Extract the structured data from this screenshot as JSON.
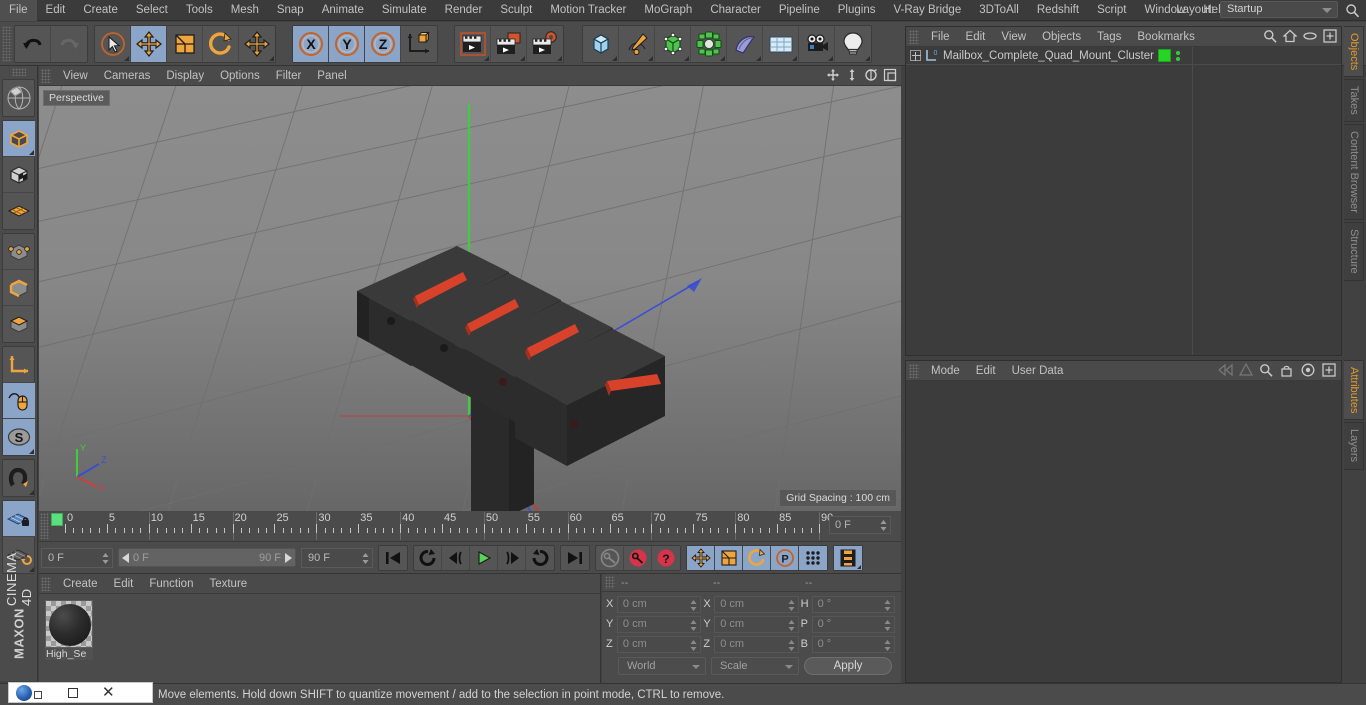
{
  "app": {
    "title": "MAXON CINEMA 4D",
    "brand_line1": "MAXON",
    "brand_line2": "CINEMA 4D"
  },
  "menubar": {
    "items": [
      "File",
      "Edit",
      "Create",
      "Select",
      "Tools",
      "Mesh",
      "Snap",
      "Animate",
      "Simulate",
      "Render",
      "Sculpt",
      "Motion Tracker",
      "MoGraph",
      "Character",
      "Pipeline",
      "Plugins",
      "V-Ray Bridge",
      "3DToAll",
      "Redshift",
      "Script",
      "Window",
      "Help"
    ],
    "layout_label": "Layout:",
    "layout_value": "Startup",
    "search_icon": "search-icon"
  },
  "toolbar": {
    "groups": [
      {
        "name": "history",
        "buttons": [
          {
            "name": "undo-button",
            "icon": "undo-icon",
            "active": false,
            "corner": false
          },
          {
            "name": "redo-button",
            "icon": "redo-icon",
            "active": false,
            "corner": false
          }
        ]
      },
      {
        "name": "transform-tools",
        "buttons": [
          {
            "name": "live-selection-tool",
            "icon": "cursor-circle-icon",
            "active": false,
            "corner": true
          },
          {
            "name": "move-tool",
            "icon": "move-arrows-icon",
            "active": true,
            "corner": false
          },
          {
            "name": "scale-tool",
            "icon": "scale-box-icon",
            "active": false,
            "corner": false
          },
          {
            "name": "rotate-tool",
            "icon": "rotate-arc-icon",
            "active": false,
            "corner": false
          },
          {
            "name": "free-move-tool",
            "icon": "move-arrows-icon",
            "active": false,
            "corner": true
          }
        ]
      },
      {
        "name": "axis-locks",
        "buttons": [
          {
            "name": "lock-x-axis-button",
            "icon": "x-axis-icon",
            "active": true,
            "corner": false
          },
          {
            "name": "lock-y-axis-button",
            "icon": "y-axis-icon",
            "active": true,
            "corner": false
          },
          {
            "name": "lock-z-axis-button",
            "icon": "z-axis-icon",
            "active": true,
            "corner": false
          },
          {
            "name": "world-object-axis-button",
            "icon": "world-axis-cube-icon",
            "active": false,
            "corner": false
          }
        ]
      },
      {
        "name": "render-group",
        "buttons": [
          {
            "name": "render-view-button",
            "icon": "render-view-icon",
            "active": false,
            "corner": true
          },
          {
            "name": "render-region-button",
            "icon": "render-region-icon",
            "active": false,
            "corner": true
          },
          {
            "name": "render-settings-button",
            "icon": "render-settings-icon",
            "active": false,
            "corner": true
          }
        ]
      },
      {
        "name": "create-group",
        "buttons": [
          {
            "name": "add-cube-button",
            "icon": "cube-icon",
            "active": false,
            "corner": true
          },
          {
            "name": "add-spline-button",
            "icon": "pen-spline-icon",
            "active": false,
            "corner": true
          },
          {
            "name": "add-generator-button",
            "icon": "green-cube-generator-icon",
            "active": false,
            "corner": true
          },
          {
            "name": "add-deformer-button",
            "icon": "deformer-icon",
            "active": false,
            "corner": true
          },
          {
            "name": "add-scene-object-button",
            "icon": "bend-object-icon",
            "active": false,
            "corner": true
          },
          {
            "name": "add-environment-button",
            "icon": "floor-grid-icon",
            "active": false,
            "corner": true
          },
          {
            "name": "add-camera-button",
            "icon": "camera-icon",
            "active": false,
            "corner": true
          },
          {
            "name": "add-light-button",
            "icon": "light-bulb-icon",
            "active": false,
            "corner": true
          }
        ]
      }
    ]
  },
  "left_toolbar": {
    "groups": [
      {
        "name": "selection-modes-top",
        "buttons": [
          {
            "name": "make-editable-button",
            "icon": "make-editable-icon",
            "active": false,
            "corner": false
          }
        ]
      },
      {
        "name": "object-modes",
        "buttons": [
          {
            "name": "model-mode-button",
            "icon": "model-cube-icon",
            "active": true,
            "corner": true
          },
          {
            "name": "texture-mode-button",
            "icon": "texture-checker-cube-icon",
            "active": false,
            "corner": false
          },
          {
            "name": "workplane-mode-button",
            "icon": "workplane-grid-icon",
            "active": false,
            "corner": false
          }
        ]
      },
      {
        "name": "component-modes",
        "buttons": [
          {
            "name": "point-mode-button",
            "icon": "point-mode-icon",
            "active": false,
            "corner": false
          },
          {
            "name": "edge-mode-button",
            "icon": "edge-mode-icon",
            "active": false,
            "corner": false
          },
          {
            "name": "polygon-mode-button",
            "icon": "polygon-mode-icon",
            "active": false,
            "corner": false
          }
        ]
      },
      {
        "name": "axis-tools",
        "buttons": [
          {
            "name": "enable-axis-button",
            "icon": "axis-l-icon",
            "active": false,
            "corner": false
          },
          {
            "name": "viewport-solo-button",
            "icon": "mouse-spline-icon",
            "active": true,
            "corner": false
          },
          {
            "name": "soft-selection-button",
            "icon": "s-circle-icon",
            "active": true,
            "corner": true
          }
        ]
      },
      {
        "name": "snap-tools",
        "buttons": [
          {
            "name": "enable-snap-button",
            "icon": "magnet-icon",
            "active": false,
            "corner": true
          }
        ]
      },
      {
        "name": "workplane-tools",
        "buttons": [
          {
            "name": "lock-workplane-button",
            "icon": "workplane-lock-icon",
            "active": true,
            "corner": false
          },
          {
            "name": "planar-workplane-button",
            "icon": "workplane-rotate-icon",
            "active": false,
            "corner": true
          }
        ]
      }
    ]
  },
  "viewport": {
    "menu_items": [
      "View",
      "Cameras",
      "Display",
      "Options",
      "Filter",
      "Panel"
    ],
    "view_label": "Perspective",
    "grid_spacing": "Grid Spacing : 100 cm",
    "nav_icons": [
      "pan-view-icon",
      "zoom-view-icon",
      "rotate-view-icon",
      "maximize-view-icon"
    ],
    "axis_gizmo": {
      "x": "X",
      "y": "Y",
      "z": "Z"
    },
    "scene_description": "Four dark mailbox boxes with red flags mounted in a diagonal row on a post"
  },
  "timeline": {
    "ticks": [
      "0",
      "5",
      "10",
      "15",
      "20",
      "25",
      "30",
      "35",
      "40",
      "45",
      "50",
      "55",
      "60",
      "65",
      "70",
      "75",
      "80",
      "85",
      "90"
    ],
    "current_frame_field": "0 F",
    "playhead_frame": 0
  },
  "transport": {
    "current_frame": "0 F",
    "range_start": "0 F",
    "range_end": "90 F",
    "max_frame": "90 F",
    "buttons": [
      {
        "name": "go-to-start-button",
        "icon": "skip-start-icon",
        "active": false
      },
      {
        "name": "play-reverse-loop-button",
        "icon": "loop-reverse-icon",
        "active": false
      },
      {
        "name": "step-back-button",
        "icon": "step-back-icon",
        "active": false
      },
      {
        "name": "play-button",
        "icon": "play-icon",
        "active": false
      },
      {
        "name": "step-forward-button",
        "icon": "step-forward-icon",
        "active": false
      },
      {
        "name": "play-forward-loop-button",
        "icon": "loop-forward-icon",
        "active": false
      },
      {
        "name": "go-to-end-button",
        "icon": "skip-end-icon",
        "active": false
      },
      {
        "name": "record-active-objects-button",
        "icon": "key-gray-icon",
        "active": false
      },
      {
        "name": "autokeying-button",
        "icon": "record-red-icon",
        "active": false
      },
      {
        "name": "keyframe-selection-button",
        "icon": "question-red-icon",
        "active": false
      },
      {
        "name": "position-key-button",
        "icon": "move-arrows-icon",
        "active": true
      },
      {
        "name": "scale-key-button",
        "icon": "scale-box-icon",
        "active": true
      },
      {
        "name": "rotation-key-button",
        "icon": "rotate-arc-icon",
        "active": true
      },
      {
        "name": "parameter-key-button",
        "icon": "p-circle-icon",
        "active": true
      },
      {
        "name": "point-level-animation-button",
        "icon": "dots-grid-icon",
        "active": true
      },
      {
        "name": "timeline-toggle-button",
        "icon": "filmstrip-icon",
        "active": true
      }
    ]
  },
  "material_manager": {
    "menu_items": [
      "Create",
      "Edit",
      "Function",
      "Texture"
    ],
    "materials": [
      {
        "name": "High_Se",
        "full_name": "High_Se"
      }
    ]
  },
  "coordinate_manager": {
    "header_dashes": [
      "--",
      "--",
      "--"
    ],
    "rows": [
      {
        "pos_label": "X",
        "pos_value": "0 cm",
        "size_label": "X",
        "size_value": "0 cm",
        "rot_label": "H",
        "rot_value": "0 °"
      },
      {
        "pos_label": "Y",
        "pos_value": "0 cm",
        "size_label": "Y",
        "size_value": "0 cm",
        "rot_label": "P",
        "rot_value": "0 °"
      },
      {
        "pos_label": "Z",
        "pos_value": "0 cm",
        "size_label": "Z",
        "size_value": "0 cm",
        "rot_label": "B",
        "rot_value": "0 °"
      }
    ],
    "coord_system": "World",
    "size_mode": "Scale",
    "apply_label": "Apply"
  },
  "object_manager": {
    "menu_items": [
      "File",
      "Edit",
      "View",
      "Objects",
      "Tags",
      "Bookmarks"
    ],
    "header_icons": [
      "search-icon",
      "home-icon",
      "ellipse-icon",
      "plus-box-icon"
    ],
    "objects": [
      {
        "name": "Mailbox_Complete_Quad_Mount_Cluster",
        "icon": "null-object-icon",
        "layer_badge": "0",
        "tag_color": "#25d425"
      }
    ]
  },
  "attribute_manager": {
    "menu_items": [
      "Mode",
      "Edit",
      "User Data"
    ],
    "header_icons": [
      "back-arrows-icon",
      "forward-arrow-icon",
      "search-icon",
      "lock-icon",
      "target-icon",
      "plus-box-icon"
    ]
  },
  "right_tabs": {
    "top": [
      {
        "label": "Objects",
        "active": true
      },
      {
        "label": "Takes",
        "active": false
      },
      {
        "label": "Content Browser",
        "active": false
      },
      {
        "label": "Structure",
        "active": false
      }
    ],
    "bottom": [
      {
        "label": "Attributes",
        "active": true
      },
      {
        "label": "Layers",
        "active": false
      }
    ]
  },
  "statusbar": {
    "text": "Move elements. Hold down SHIFT to quantize movement / add to the selection in point mode, CTRL to remove."
  },
  "window_widget": {
    "logo": "browser-logo-icon",
    "restore": "restore-icon",
    "minimize": "minimize-icon",
    "close": "close-icon"
  },
  "colors": {
    "accent_orange": "#e08a2c",
    "active_blue": "#8ba5c9",
    "panel_bg": "#4b4b4b",
    "dark_panel": "#3c3c3c",
    "tag_green": "#25d425",
    "axis_x": "#d84040",
    "axis_y": "#3fc23f",
    "axis_z": "#4060d8",
    "mailbox_flag": "#d8422a"
  }
}
